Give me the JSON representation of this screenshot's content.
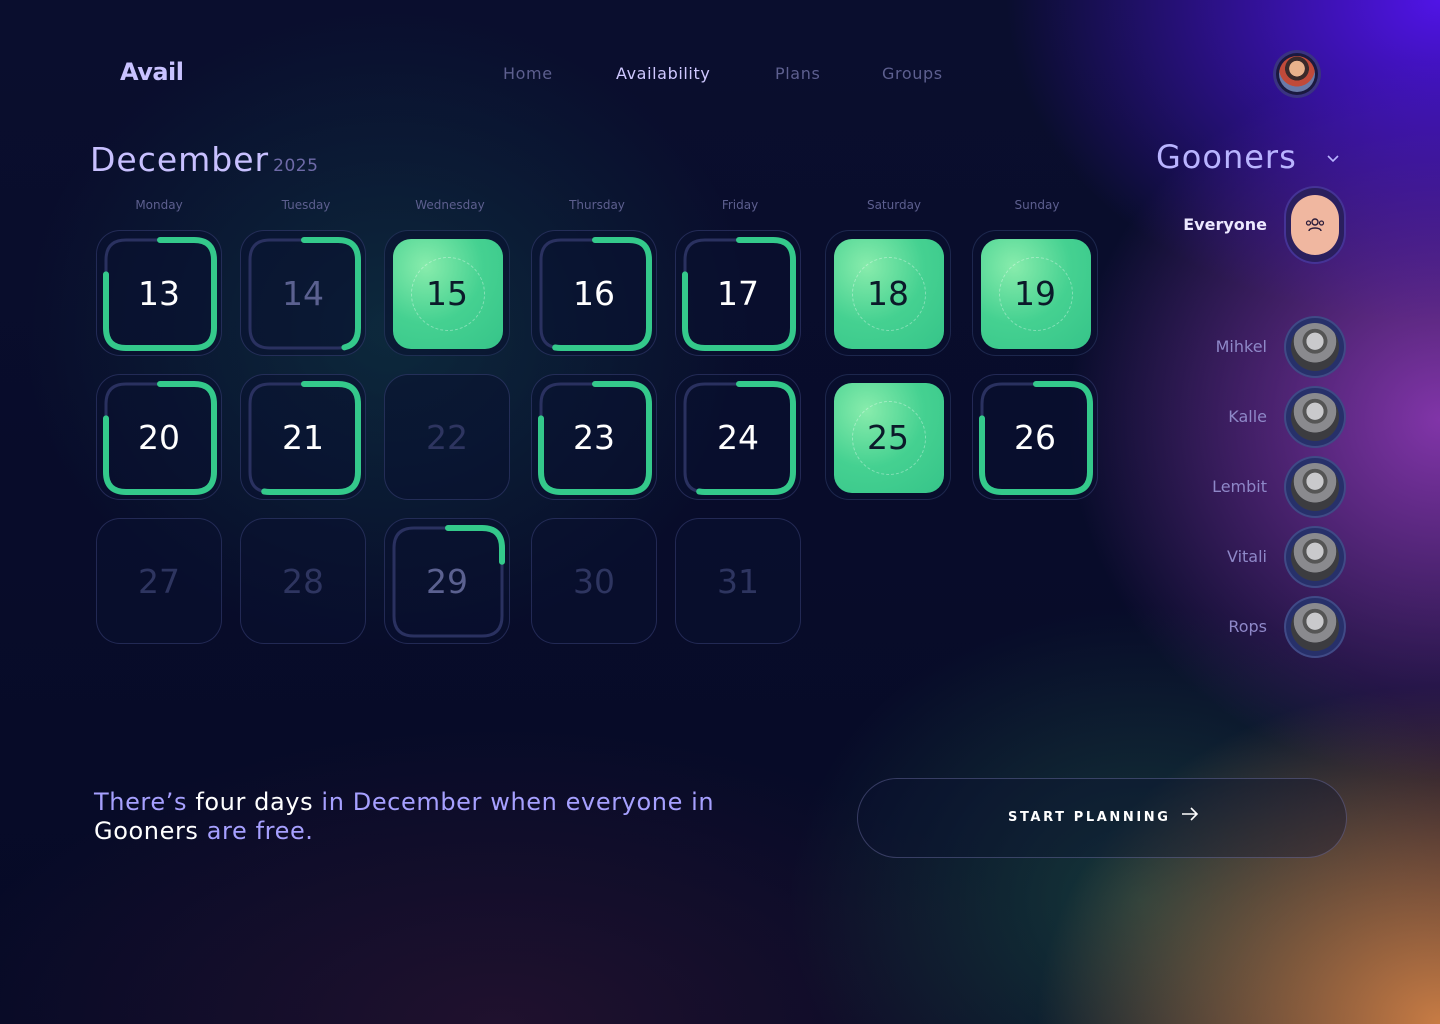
{
  "app": {
    "name": "Avail"
  },
  "nav": [
    {
      "label": "Home",
      "active": false
    },
    {
      "label": "Availability",
      "active": true
    },
    {
      "label": "Plans",
      "active": false
    },
    {
      "label": "Groups",
      "active": false
    }
  ],
  "calendar": {
    "month": "December",
    "year": "2025",
    "weekdays": [
      "Monday",
      "Tuesday",
      "Wednesday",
      "Thursday",
      "Friday",
      "Saturday",
      "Sunday"
    ],
    "days": [
      {
        "day": "13",
        "availability": 0.8,
        "state": "partial"
      },
      {
        "day": "14",
        "availability": 0.4,
        "state": "partial"
      },
      {
        "day": "15",
        "availability": 1.0,
        "state": "full"
      },
      {
        "day": "16",
        "availability": 0.6,
        "state": "partial"
      },
      {
        "day": "17",
        "availability": 0.8,
        "state": "partial"
      },
      {
        "day": "18",
        "availability": 1.0,
        "state": "full"
      },
      {
        "day": "19",
        "availability": 1.0,
        "state": "full"
      },
      {
        "day": "20",
        "availability": 0.8,
        "state": "partial"
      },
      {
        "day": "21",
        "availability": 0.6,
        "state": "partial"
      },
      {
        "day": "22",
        "availability": 0.0,
        "state": "none"
      },
      {
        "day": "23",
        "availability": 0.8,
        "state": "partial"
      },
      {
        "day": "24",
        "availability": 0.6,
        "state": "partial"
      },
      {
        "day": "25",
        "availability": 1.0,
        "state": "full"
      },
      {
        "day": "26",
        "availability": 0.8,
        "state": "partial"
      },
      {
        "day": "27",
        "availability": 0.0,
        "state": "none"
      },
      {
        "day": "28",
        "availability": 0.0,
        "state": "none"
      },
      {
        "day": "29",
        "availability": 0.2,
        "state": "partial"
      },
      {
        "day": "30",
        "availability": 0.0,
        "state": "none"
      },
      {
        "day": "31",
        "availability": 0.0,
        "state": "none"
      }
    ]
  },
  "group": {
    "name": "Gooners",
    "everyone_label": "Everyone",
    "members": [
      "Mihkel",
      "Kalle",
      "Lembit",
      "Vitali",
      "Rops"
    ]
  },
  "summary": {
    "part1": "There’s ",
    "highlight1": "four days",
    "part2": " in December when everyone in ",
    "highlight2": "Gooners",
    "part3": " are free."
  },
  "cta": {
    "label": "START PLANNING"
  },
  "icons": {
    "everyone": "group-icon",
    "cta": "arrow-right-icon",
    "dropdown": "chevron-down-icon"
  },
  "colors": {
    "accent_green": "#34c98b",
    "accent_purple": "#b9b4ff",
    "background": "#070b26"
  }
}
